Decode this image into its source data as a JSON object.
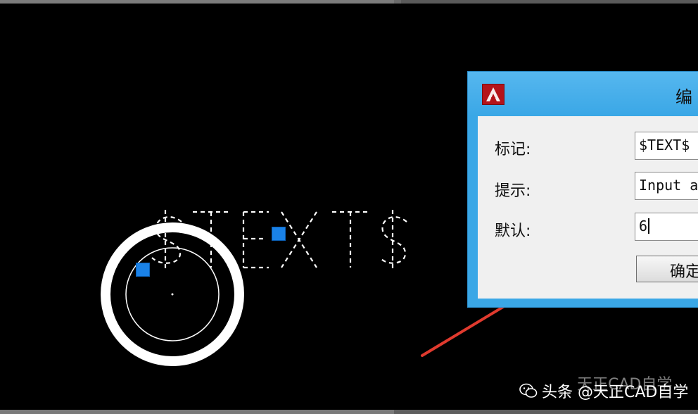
{
  "dialog": {
    "title_fragment": "编",
    "tag_label": "标记:",
    "tag_value": "$TEXT$",
    "prompt_label": "提示:",
    "prompt_value": "Input a",
    "default_label": "默认:",
    "default_value": "6",
    "ok_label": "确定"
  },
  "drawing": {
    "attribute_tag_text": "$TEXT$",
    "grip_color": "#1a82e8"
  },
  "annotation": {
    "arrow_color": "#e03a2e"
  },
  "watermark": {
    "text": "头条 @天正CAD自学",
    "ghost_text": "天正CAD自学"
  },
  "icons": {
    "app": "autocad-logo-icon",
    "watermark": "wechat-icon"
  }
}
